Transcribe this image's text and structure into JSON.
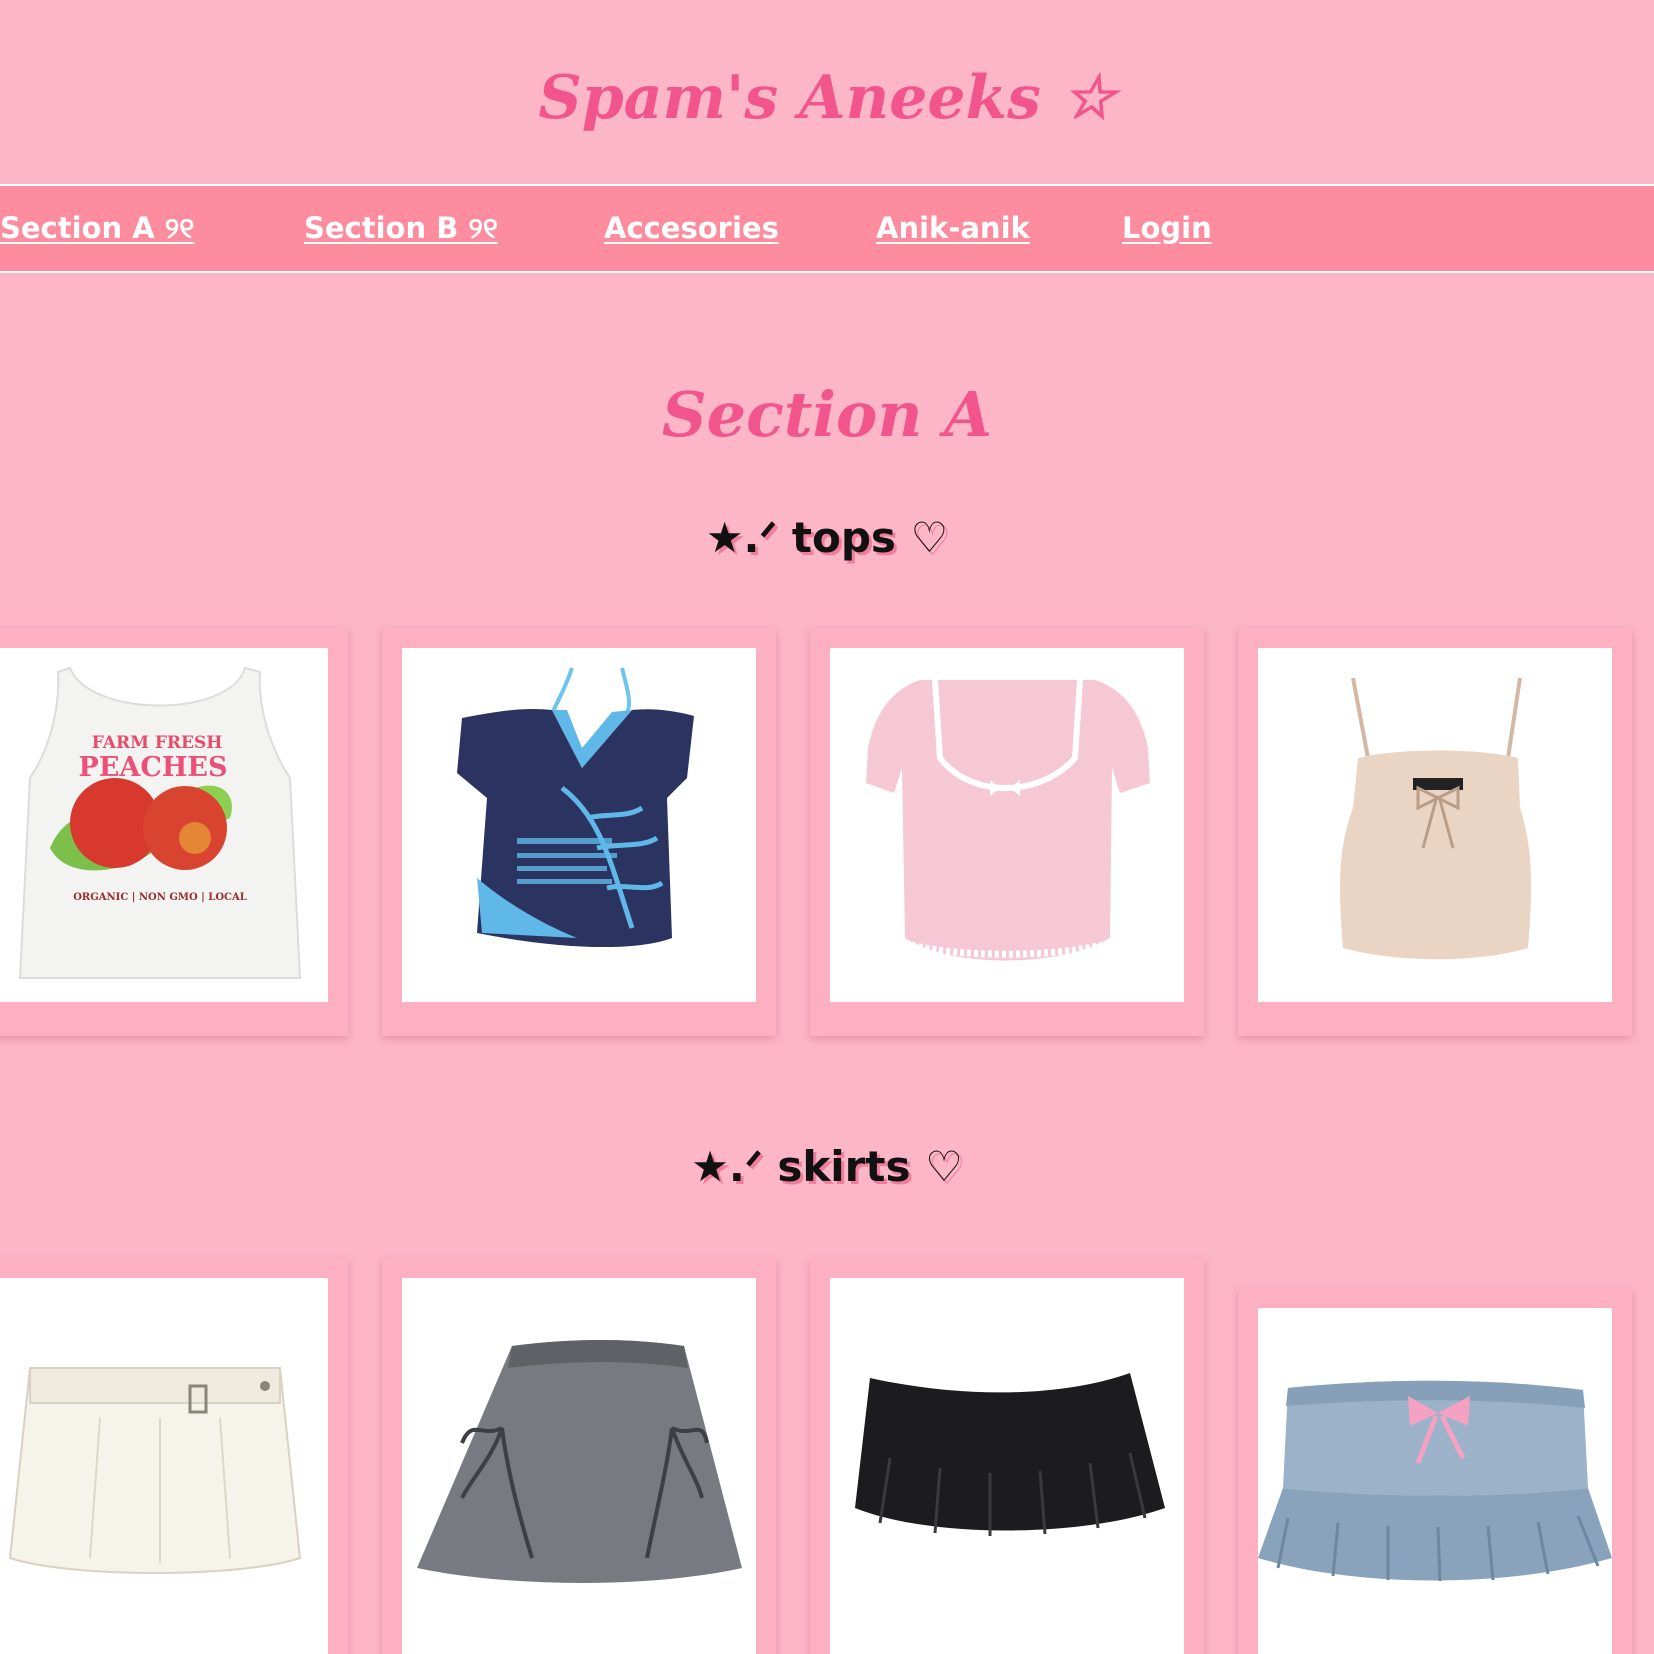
{
  "site": {
    "title": "Spam's Aneeks ☆"
  },
  "nav": {
    "items": [
      {
        "label": "Section A ୨୧"
      },
      {
        "label": "Section B ୨୧"
      },
      {
        "label": "Accesories"
      },
      {
        "label": "Anik-anik"
      },
      {
        "label": "Login"
      }
    ]
  },
  "section": {
    "title": "Section A"
  },
  "categories": [
    {
      "title": "★.ᐟ tops ♡",
      "products": [
        {
          "image": "white-peach-graphic-tank-top",
          "print": {
            "line1": "FARM FRESH",
            "line2": "PEACHES",
            "line3": "ORGANIC | NON GMO | LOCAL"
          }
        },
        {
          "image": "navy-halter-graphic-tee"
        },
        {
          "image": "pink-lace-trim-top"
        },
        {
          "image": "beige-bow-camisole"
        }
      ]
    },
    {
      "title": "★.ᐟ skirts ♡",
      "products": [
        {
          "image": "white-belted-mini-skirt"
        },
        {
          "image": "grey-bow-mini-skirt"
        },
        {
          "image": "black-pleated-mini-skirt"
        },
        {
          "image": "denim-ruffle-mini-skirt"
        }
      ]
    }
  ]
}
